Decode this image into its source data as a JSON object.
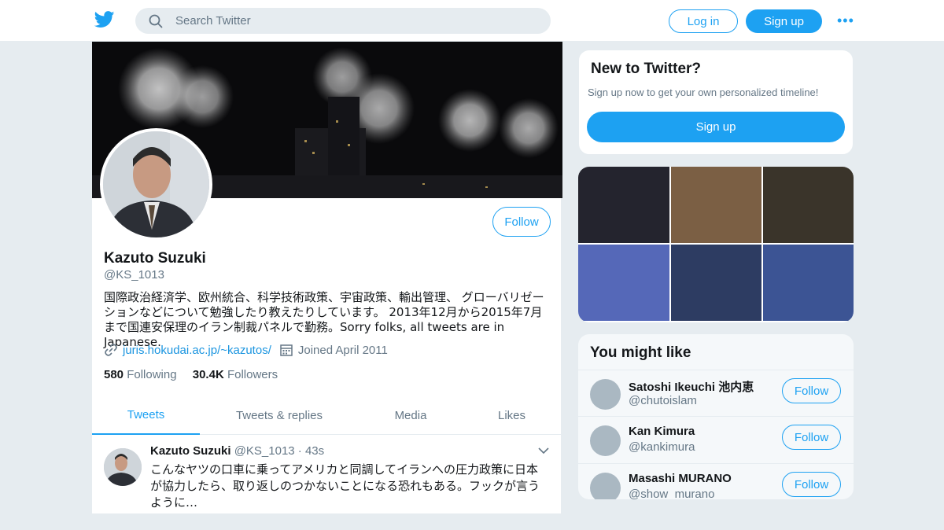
{
  "header": {
    "search_placeholder": "Search Twitter",
    "login_label": "Log in",
    "signup_label": "Sign up",
    "more_label": "•••"
  },
  "profile": {
    "name": "Kazuto Suzuki",
    "handle": "@KS_1013",
    "follow_label": "Follow",
    "bio": "国際政治経済学、欧州統合、科学技術政策、宇宙政策、輸出管理、 グローバリゼーションなどについて勉強したり教えたりしています。 2013年12月から2015年7月まで国連安保理のイラン制裁パネルで勤務。Sorry folks, all tweets are in Japanese.",
    "url": "juris.hokudai.ac.jp/~kazutos/",
    "joined": "Joined April 2011",
    "following_count": "580",
    "following_label": "Following",
    "followers_count": "30.4K",
    "followers_label": "Followers"
  },
  "tabs": [
    {
      "label": "Tweets"
    },
    {
      "label": "Tweets & replies"
    },
    {
      "label": "Media"
    },
    {
      "label": "Likes"
    }
  ],
  "tweet": {
    "name": "Kazuto Suzuki",
    "handle": "@KS_1013 · 43s",
    "text": "こんなヤツの口車に乗ってアメリカと同調してイランへの圧力政策に日本が協力したら、取り返しのつかないことになる恐れもある。フックが言うように…"
  },
  "new_to_twitter": {
    "title": "New to Twitter?",
    "subtitle": "Sign up now to get your own personalized timeline!",
    "button": "Sign up"
  },
  "media_colors": [
    "#24242e",
    "#7b5f44",
    "#3a342a",
    "#5568b8",
    "#2d3c62",
    "#3c5494"
  ],
  "you_might_like": {
    "title": "You might like",
    "users": [
      {
        "name": "Satoshi Ikeuchi 池内恵",
        "handle": "@chutoislam",
        "follow": "Follow"
      },
      {
        "name": "Kan Kimura",
        "handle": "@kankimura",
        "follow": "Follow"
      },
      {
        "name": "Masashi MURANO",
        "handle": "@show_murano",
        "follow": "Follow"
      }
    ]
  },
  "colors": {
    "accent": "#1da1f2",
    "text": "#14171a",
    "secondary": "#657786"
  }
}
